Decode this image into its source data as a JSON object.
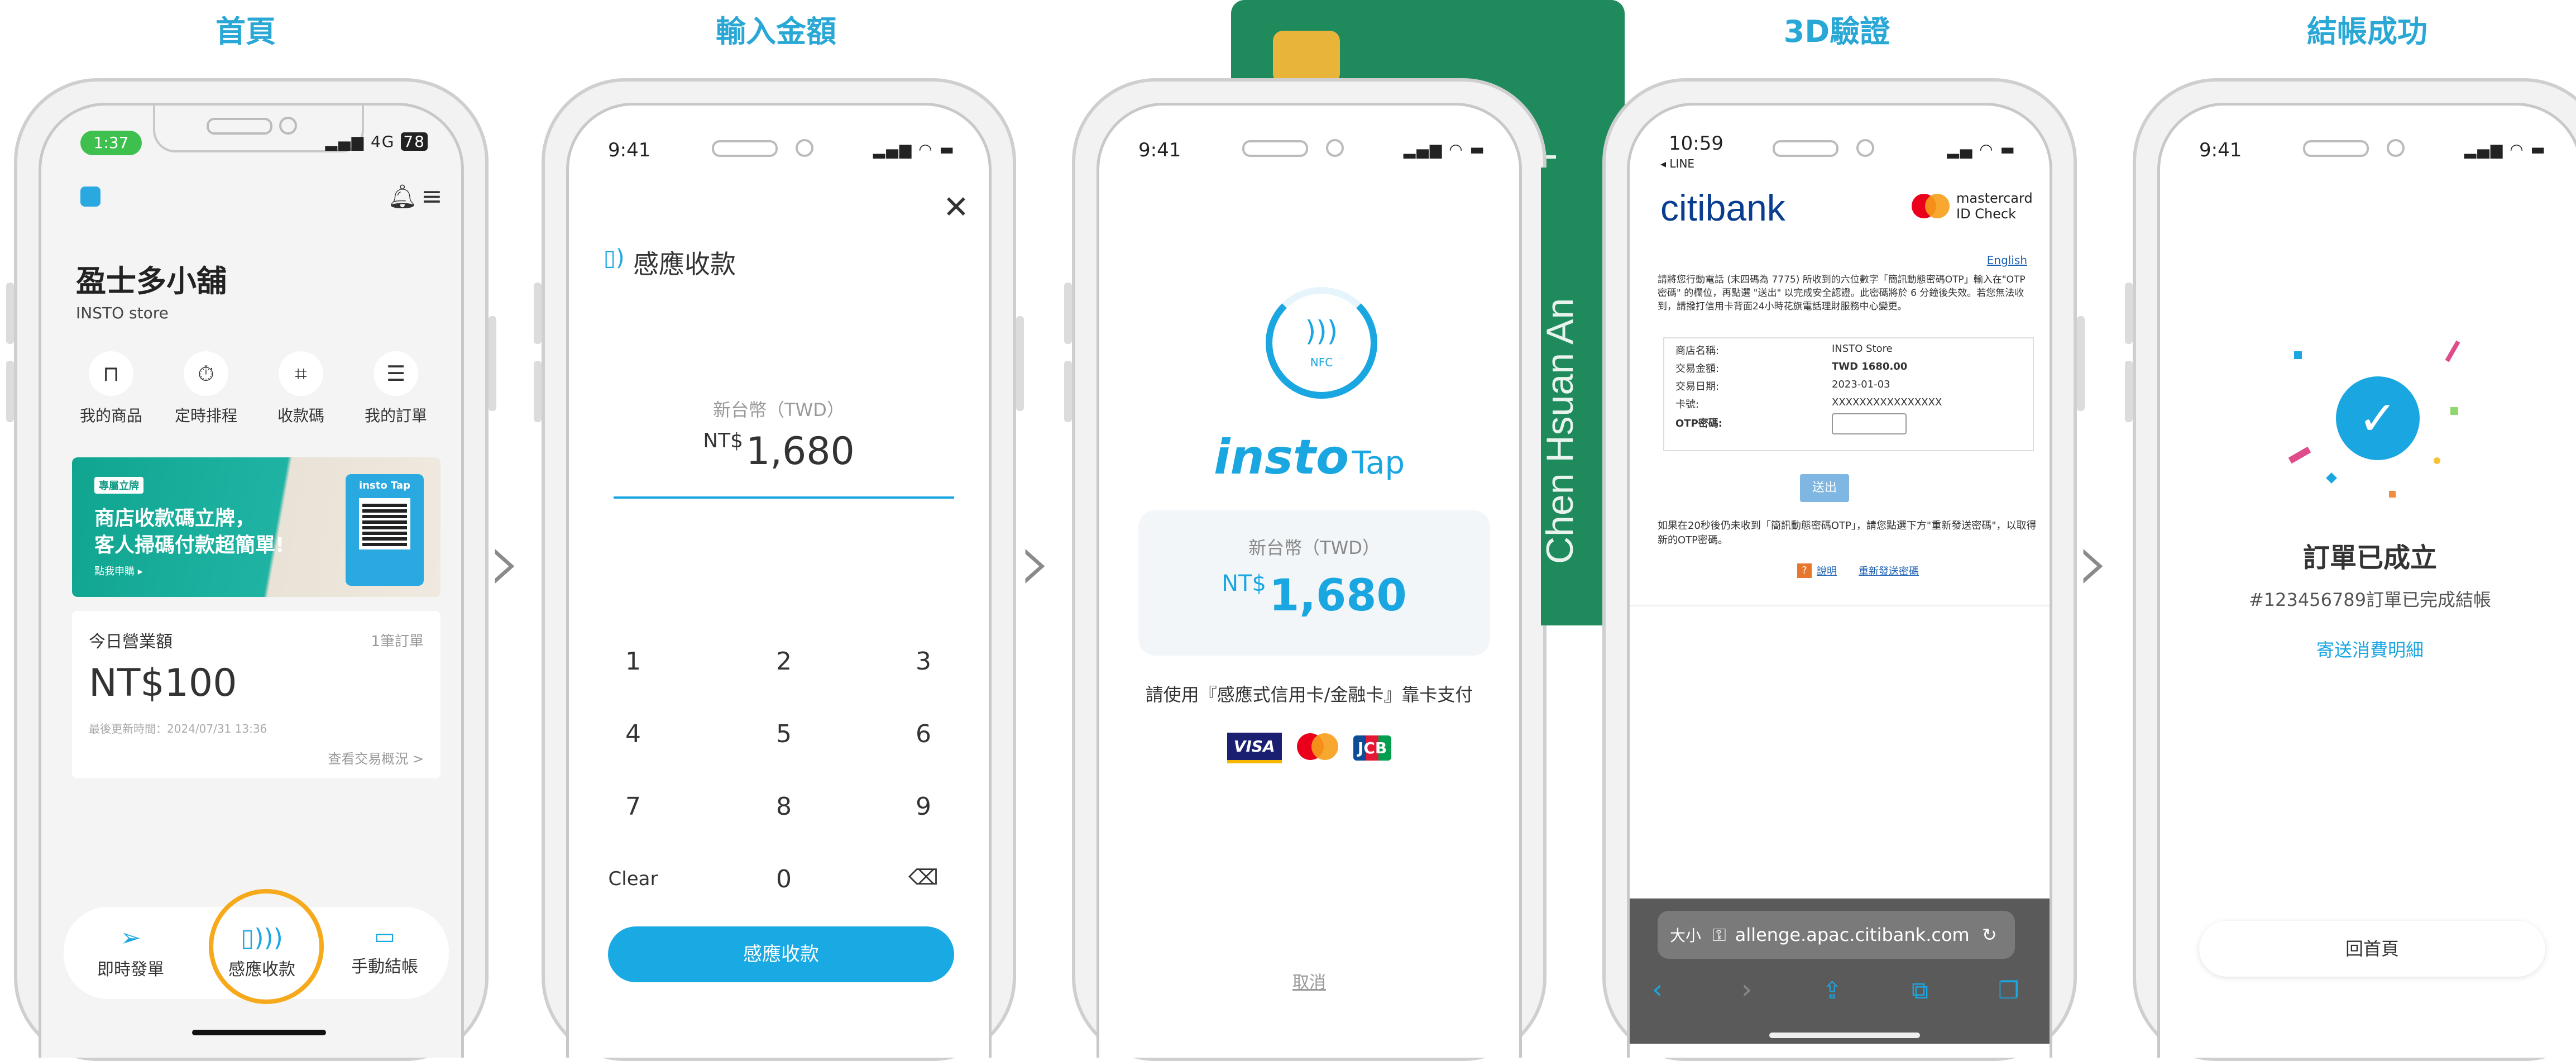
{
  "stages": [
    {
      "title": "首頁"
    },
    {
      "title": "輸入金額"
    },
    {
      "title": ""
    },
    {
      "title": "3D驗證"
    },
    {
      "title": "結帳成功"
    }
  ],
  "home": {
    "status_time": "1:37",
    "status_network": "4G",
    "status_battery": "78",
    "store_name": "盈士多小舖",
    "store_name_en": "INSTO store",
    "quick_actions": [
      {
        "label": "我的商品",
        "icon": "bag-icon"
      },
      {
        "label": "定時排程",
        "icon": "stopwatch-icon"
      },
      {
        "label": "收款碼",
        "icon": "qr-scan-icon"
      },
      {
        "label": "我的訂單",
        "icon": "order-list-icon"
      }
    ],
    "banner": {
      "tag": "專屬立牌",
      "line1": "商店收款碼立牌，",
      "line2": "客人掃碼付款超簡單!",
      "link": "點我申購 ▸",
      "stand_logo": "insto Tap"
    },
    "revenue_title": "今日營業額",
    "order_count": "1筆訂單",
    "revenue_amount": "NT$100",
    "last_updated": "最後更新時間：2024/07/31 13:36",
    "view_more": "查看交易概況 >",
    "bottom_nav": [
      {
        "label": "即時發單",
        "icon": "send-icon"
      },
      {
        "label": "感應收款",
        "icon": "nfc-pay-icon"
      },
      {
        "label": "手動結帳",
        "icon": "cash-icon"
      }
    ],
    "highlight_color": "#f5a91b"
  },
  "amount": {
    "status_time": "9:41",
    "title": "感應收款",
    "currency": "新台幣（TWD）",
    "prefix": "NT$",
    "value": "1,680",
    "keys": [
      "1",
      "2",
      "3",
      "4",
      "5",
      "6",
      "7",
      "8",
      "9",
      "Clear",
      "0",
      "⌫"
    ],
    "button": "感應收款"
  },
  "tap": {
    "status_time": "9:41",
    "nfc_label": "NFC",
    "brand": "insto",
    "brand_suffix": "Tap",
    "currency": "新台幣（TWD）",
    "prefix": "NT$",
    "value": "1,680",
    "instruction": "請使用『感應式信用卡/金融卡』靠卡支付",
    "card_brands": [
      "VISA",
      "mastercard",
      "JCB"
    ],
    "cancel": "取消",
    "card_holder": "Chen Hsuan An",
    "card_color": "#1f8a5b"
  },
  "otp": {
    "status_time": "10:59",
    "back_app": "◂ LINE",
    "bank": "citibank",
    "scheme": "mastercard",
    "scheme_sub": "ID Check",
    "lang_link": "English",
    "intro": "請將您行動電話 (末四碼為 7775) 所收到的六位數字「簡訊動態密碼OTP」輸入在\"OTP 密碼\" 的欄位，再點選 \"送出\" 以完成安全認證。此密碼將於 6 分鐘後失效。若您無法收到，請撥打信用卡背面24小時花旗電話理財服務中心變更。",
    "rows": [
      {
        "label": "商店名稱:",
        "value": "INSTO Store"
      },
      {
        "label": "交易金額:",
        "value": "TWD 1680.00"
      },
      {
        "label": "交易日期:",
        "value": "2023-01-03"
      },
      {
        "label": "卡號:",
        "value": "XXXXXXXXXXXXXXXX"
      },
      {
        "label": "OTP密碼:",
        "value": ""
      }
    ],
    "submit": "送出",
    "resend_note": "如果在20秒後仍未收到「簡訊動態密碼OTP」，請您點選下方\"重新發送密碼\"，以取得新的OTP密碼。",
    "help_link": "說明",
    "resend_link": "重新發送密碼",
    "browser_size": "大小",
    "browser_url": "allenge.apac.citibank.com"
  },
  "success": {
    "status_time": "9:41",
    "title": "訂單已成立",
    "subtitle": "#123456789訂單已完成結帳",
    "link": "寄送消費明細",
    "button": "回首頁"
  }
}
